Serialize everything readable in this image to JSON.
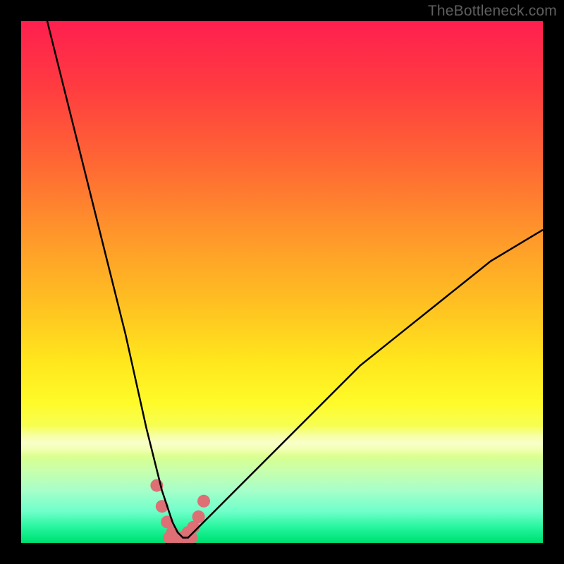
{
  "watermark": "TheBottleneck.com",
  "chart_data": {
    "type": "line",
    "title": "",
    "xlabel": "",
    "ylabel": "",
    "xlim": [
      0,
      100
    ],
    "ylim": [
      0,
      100
    ],
    "grid": false,
    "legend": false,
    "background_gradient": {
      "top": "#ff1f4f",
      "mid": "#ffe61d",
      "bottom": "#00e172"
    },
    "series": [
      {
        "name": "bottleneck-curve",
        "color": "#000000",
        "x": [
          5,
          8,
          11,
          14,
          17,
          20,
          22,
          24,
          26,
          27,
          28,
          29,
          30,
          31,
          32,
          33,
          35,
          37,
          40,
          45,
          50,
          55,
          60,
          65,
          70,
          75,
          80,
          85,
          90,
          95,
          100
        ],
        "y": [
          100,
          88,
          76,
          64,
          52,
          40,
          31,
          22,
          14,
          10,
          7,
          4,
          2,
          1,
          1,
          2,
          4,
          6,
          9,
          14,
          19,
          24,
          29,
          34,
          38,
          42,
          46,
          50,
          54,
          57,
          60
        ]
      }
    ],
    "marker_band": {
      "name": "optimal-range",
      "color": "#dd6f75",
      "x": [
        26,
        27,
        28,
        29,
        30,
        31,
        32,
        33,
        34,
        35
      ],
      "y": [
        11,
        7,
        4,
        2,
        1,
        1,
        2,
        3,
        5,
        8
      ]
    }
  }
}
